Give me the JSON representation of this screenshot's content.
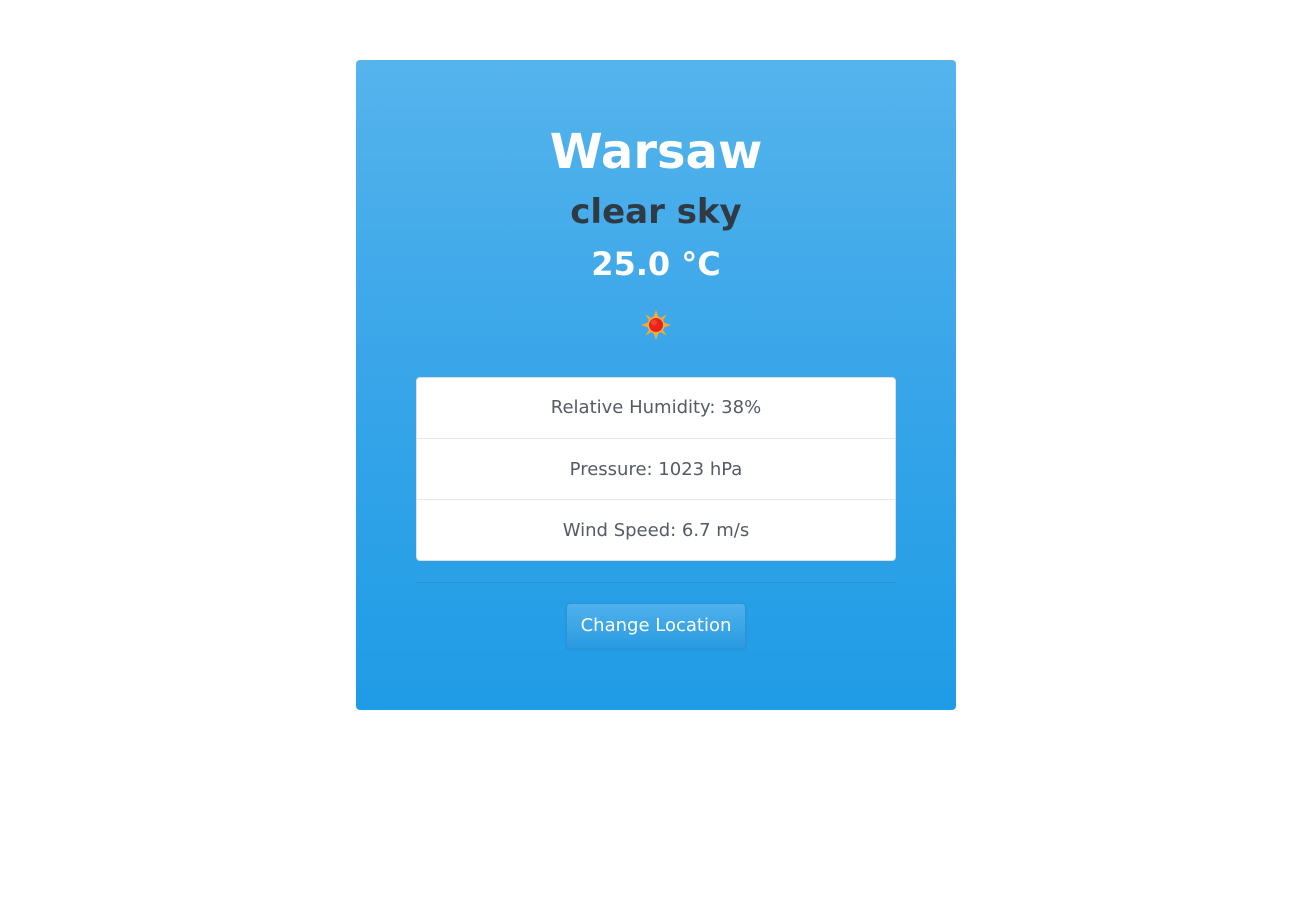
{
  "weather": {
    "city": "Warsaw",
    "description": "clear sky",
    "temperature": "25.0 °C",
    "icon": "sun-icon"
  },
  "details": [
    {
      "label": "Relative Humidity: 38%"
    },
    {
      "label": "Pressure: 1023 hPa"
    },
    {
      "label": "Wind Speed: 6.7 m/s"
    }
  ],
  "actions": {
    "change_location_label": "Change Location"
  },
  "colors": {
    "card_top": "#55b4ec",
    "card_bottom": "#1f9ce6",
    "title_text": "#ffffff",
    "description_text": "#2f3a44",
    "list_text": "#555b63"
  }
}
